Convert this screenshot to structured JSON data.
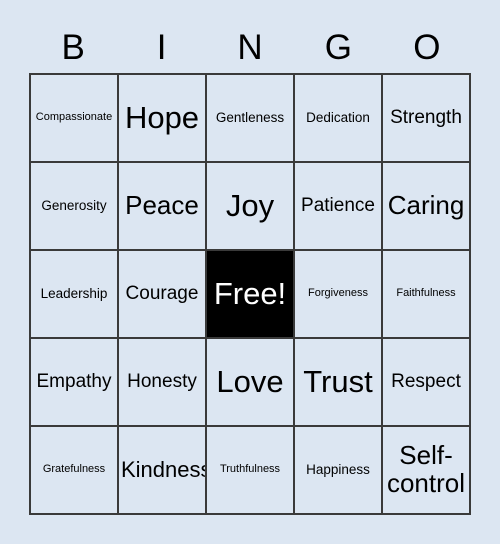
{
  "header": {
    "letters": [
      "B",
      "I",
      "N",
      "G",
      "O"
    ]
  },
  "grid": {
    "rows": 5,
    "columns": 5,
    "background_color": "#dce6f2",
    "border_color": "#3a3a3a",
    "free_space_color": "#000000",
    "free_space_text_color": "#ffffff",
    "cells": [
      {
        "label": "Compassionate",
        "size": "s-xs",
        "marked": false
      },
      {
        "label": "Hope",
        "size": "s-xxl",
        "marked": false
      },
      {
        "label": "Gentleness",
        "size": "s-sm",
        "marked": false
      },
      {
        "label": "Dedication",
        "size": "s-sm",
        "marked": false
      },
      {
        "label": "Strength",
        "size": "s-md",
        "marked": false
      },
      {
        "label": "Generosity",
        "size": "s-sm",
        "marked": false
      },
      {
        "label": "Peace",
        "size": "s-xl",
        "marked": false
      },
      {
        "label": "Joy",
        "size": "s-xxl",
        "marked": false
      },
      {
        "label": "Patience",
        "size": "s-md",
        "marked": false
      },
      {
        "label": "Caring",
        "size": "s-xl",
        "marked": false
      },
      {
        "label": "Leadership",
        "size": "s-sm",
        "marked": false
      },
      {
        "label": "Courage",
        "size": "s-md",
        "marked": false
      },
      {
        "label": "Free!",
        "size": "s-xxl",
        "marked": true
      },
      {
        "label": "Forgiveness",
        "size": "s-xs",
        "marked": false
      },
      {
        "label": "Faithfulness",
        "size": "s-xs",
        "marked": false
      },
      {
        "label": "Empathy",
        "size": "s-md",
        "marked": false
      },
      {
        "label": "Honesty",
        "size": "s-md",
        "marked": false
      },
      {
        "label": "Love",
        "size": "s-xxl",
        "marked": false
      },
      {
        "label": "Trust",
        "size": "s-xxl",
        "marked": false
      },
      {
        "label": "Respect",
        "size": "s-md",
        "marked": false
      },
      {
        "label": "Gratefulness",
        "size": "s-xs",
        "marked": false
      },
      {
        "label": "Kindness",
        "size": "s-lg",
        "marked": false
      },
      {
        "label": "Truthfulness",
        "size": "s-xs",
        "marked": false
      },
      {
        "label": "Happiness",
        "size": "s-sm",
        "marked": false
      },
      {
        "label": "Self-\ncontrol",
        "size": "s-xl",
        "marked": false
      }
    ]
  }
}
